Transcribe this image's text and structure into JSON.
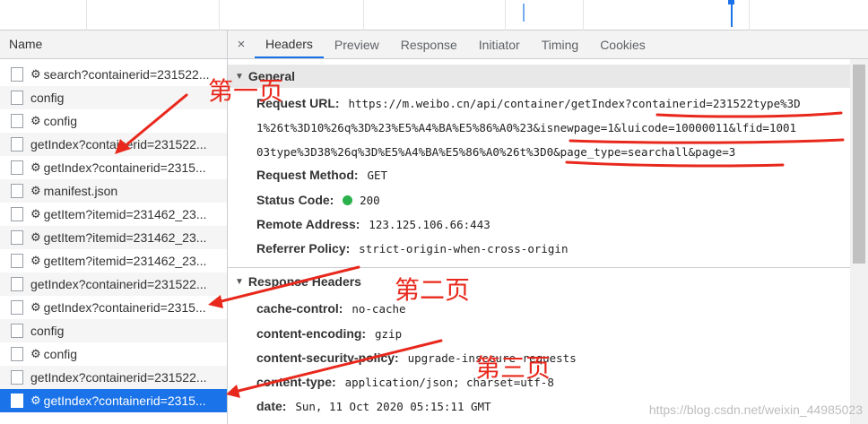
{
  "request_list": {
    "header": "Name",
    "rows": [
      {
        "icon": "gear",
        "name": "search?containerid=231522..."
      },
      {
        "icon": "",
        "name": "config"
      },
      {
        "icon": "gear",
        "name": "config"
      },
      {
        "icon": "",
        "name": "getIndex?containerid=231522..."
      },
      {
        "icon": "gear",
        "name": "getIndex?containerid=2315..."
      },
      {
        "icon": "gear",
        "name": "manifest.json"
      },
      {
        "icon": "gear",
        "name": "getItem?itemid=231462_23..."
      },
      {
        "icon": "gear",
        "name": "getItem?itemid=231462_23..."
      },
      {
        "icon": "gear",
        "name": "getItem?itemid=231462_23..."
      },
      {
        "icon": "",
        "name": "getIndex?containerid=231522..."
      },
      {
        "icon": "gear",
        "name": "getIndex?containerid=2315..."
      },
      {
        "icon": "",
        "name": "config"
      },
      {
        "icon": "gear",
        "name": "config"
      },
      {
        "icon": "",
        "name": "getIndex?containerid=231522..."
      },
      {
        "icon": "gear",
        "name": "getIndex?containerid=2315..."
      }
    ],
    "selected_index": 14
  },
  "tabs": {
    "close": "×",
    "items": [
      "Headers",
      "Preview",
      "Response",
      "Initiator",
      "Timing",
      "Cookies"
    ],
    "active": "Headers"
  },
  "general": {
    "title": "General",
    "request_url_label": "Request URL:",
    "request_url_lines": [
      "https://m.weibo.cn/api/container/getIndex?containerid=231522type%3D",
      "1%26t%3D10%26q%3D%23%E5%A4%BA%E5%86%A0%23&isnewpage=1&luicode=10000011&lfid=1001",
      "03type%3D38%26q%3D%E5%A4%BA%E5%86%A0%26t%3D0&page_type=searchall&page=3"
    ],
    "request_method_label": "Request Method:",
    "request_method": "GET",
    "status_code_label": "Status Code:",
    "status_code": "200",
    "remote_address_label": "Remote Address:",
    "remote_address": "123.125.106.66:443",
    "referrer_policy_label": "Referrer Policy:",
    "referrer_policy": "strict-origin-when-cross-origin"
  },
  "response_headers": {
    "title": "Response Headers",
    "items": [
      {
        "key": "cache-control:",
        "value": "no-cache"
      },
      {
        "key": "content-encoding:",
        "value": "gzip"
      },
      {
        "key": "content-security-policy:",
        "value": "upgrade-insecure-requests"
      },
      {
        "key": "content-type:",
        "value": "application/json; charset=utf-8"
      },
      {
        "key": "date:",
        "value": "Sun, 11 Oct 2020 05:15:11 GMT"
      }
    ]
  },
  "annotations": {
    "page1": "第一页",
    "page2": "第二页",
    "page3": "第三页",
    "color": "#e8281c"
  },
  "watermark": "https://blog.csdn.net/weixin_44985023"
}
